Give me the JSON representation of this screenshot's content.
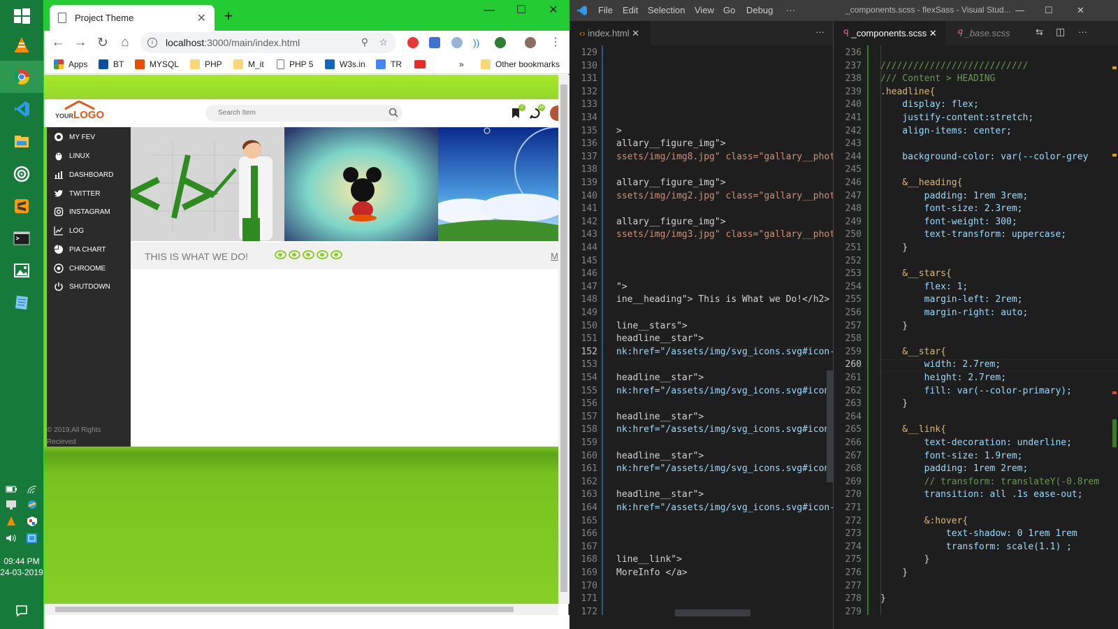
{
  "taskbar": {
    "icons": [
      "start-icon",
      "vlc-icon",
      "chrome-icon",
      "vscode-icon",
      "file-explorer-icon",
      "groove-icon",
      "sublime-icon",
      "terminal-icon",
      "photos-icon",
      "notepad-icon"
    ],
    "time": "09:44 PM",
    "date": "24-03-2019"
  },
  "chrome": {
    "tab_title": "Project Theme",
    "url_host": "localhost",
    "url_path": ":3000/main/index.html",
    "bookmarks": [
      "Apps",
      "BT",
      "MYSQL",
      "PHP",
      "M_it",
      "PHP 5",
      "W3s.in",
      "TR"
    ],
    "more_bookmarks": "»",
    "other_bookmarks": "Other bookmarks"
  },
  "site": {
    "logo_your": "YOUR",
    "logo_logo": "LOGO",
    "search_placeholder": "Search Item",
    "badge1": "0",
    "badge2": "16",
    "sidebar": [
      "MY FEV",
      "LINUX",
      "DASHBOARD",
      "TWITTER",
      "INSTAGRAM",
      "LOG",
      "PIA CHART",
      "CHROOME",
      "SHUTDOWN"
    ],
    "copyright_1": "© 2019,All Rights",
    "copyright_2": "Recieved",
    "headline": "THIS IS WHAT WE DO!",
    "more": "M"
  },
  "vscode": {
    "menu": [
      "File",
      "Edit",
      "Selection",
      "View",
      "Go",
      "Debug",
      "···"
    ],
    "window_title": "_components.scss - flexSass - Visual Stud...",
    "left_tab": "index.html",
    "right_tabs": [
      "_components.scss",
      "_base.scss"
    ],
    "left_lines": [
      {
        "n": "129",
        "t": ""
      },
      {
        "n": "130",
        "t": ""
      },
      {
        "n": "131",
        "t": ""
      },
      {
        "n": "132",
        "t": ""
      },
      {
        "n": "133",
        "t": ""
      },
      {
        "n": "134",
        "t": ""
      },
      {
        "n": "135",
        "t": ">"
      },
      {
        "n": "136",
        "t": "allary__figure_img\">"
      },
      {
        "n": "137",
        "t": "ssets/img/img8.jpg\" class=\"gallary__phot"
      },
      {
        "n": "138",
        "t": ""
      },
      {
        "n": "139",
        "t": "allary__figure_img\">"
      },
      {
        "n": "140",
        "t": "ssets/img/img2.jpg\" class=\"gallary__phot"
      },
      {
        "n": "141",
        "t": ""
      },
      {
        "n": "142",
        "t": "allary__figure_img\">"
      },
      {
        "n": "143",
        "t": "ssets/img/img3.jpg\" class=\"gallary__phot"
      },
      {
        "n": "144",
        "t": ""
      },
      {
        "n": "145",
        "t": ""
      },
      {
        "n": "146",
        "t": ""
      },
      {
        "n": "147",
        "t": "\">"
      },
      {
        "n": "148",
        "t": "ine__heading\"> This is What we Do!</h2>"
      },
      {
        "n": "149",
        "t": ""
      },
      {
        "n": "150",
        "t": "line__stars\">"
      },
      {
        "n": "151",
        "t": "headline__star\">"
      },
      {
        "n": "152",
        "t": "nk:href=\"/assets/img/svg_icons.svg#icon-"
      },
      {
        "n": "153",
        "t": ""
      },
      {
        "n": "154",
        "t": "headline__star\">"
      },
      {
        "n": "155",
        "t": "nk:href=\"/assets/img/svg_icons.svg#icon-"
      },
      {
        "n": "156",
        "t": ""
      },
      {
        "n": "157",
        "t": "headline__star\">"
      },
      {
        "n": "158",
        "t": "nk:href=\"/assets/img/svg_icons.svg#icon-"
      },
      {
        "n": "159",
        "t": ""
      },
      {
        "n": "160",
        "t": "headline__star\">"
      },
      {
        "n": "161",
        "t": "nk:href=\"/assets/img/svg_icons.svg#icon-"
      },
      {
        "n": "162",
        "t": ""
      },
      {
        "n": "163",
        "t": "headline__star\">"
      },
      {
        "n": "164",
        "t": "nk:href=\"/assets/img/svg_icons.svg#icon-"
      },
      {
        "n": "165",
        "t": ""
      },
      {
        "n": "166",
        "t": ""
      },
      {
        "n": "167",
        "t": ""
      },
      {
        "n": "168",
        "t": "line__link\">"
      },
      {
        "n": "169",
        "t": "MoreInfo </a>"
      },
      {
        "n": "170",
        "t": ""
      },
      {
        "n": "171",
        "t": ""
      },
      {
        "n": "172",
        "t": ""
      }
    ],
    "right_lines": [
      {
        "n": "236",
        "t": ""
      },
      {
        "n": "237",
        "t": "///////////////////////////"
      },
      {
        "n": "238",
        "t": "/// Content > HEADING"
      },
      {
        "n": "239",
        "t": ".headline{"
      },
      {
        "n": "240",
        "t": "    display: flex;"
      },
      {
        "n": "241",
        "t": "    justify-content:stretch;"
      },
      {
        "n": "242",
        "t": "    align-items: center;"
      },
      {
        "n": "243",
        "t": ""
      },
      {
        "n": "244",
        "t": "    background-color: var(--color-grey"
      },
      {
        "n": "245",
        "t": ""
      },
      {
        "n": "246",
        "t": "    &__heading{"
      },
      {
        "n": "247",
        "t": "        padding: 1rem 3rem;"
      },
      {
        "n": "248",
        "t": "        font-size: 2.3rem;"
      },
      {
        "n": "249",
        "t": "        font-weight: 300;"
      },
      {
        "n": "250",
        "t": "        text-transform: uppercase;"
      },
      {
        "n": "251",
        "t": "    }"
      },
      {
        "n": "252",
        "t": ""
      },
      {
        "n": "253",
        "t": "    &__stars{"
      },
      {
        "n": "254",
        "t": "        flex: 1;"
      },
      {
        "n": "255",
        "t": "        margin-left: 2rem;"
      },
      {
        "n": "256",
        "t": "        margin-right: auto;"
      },
      {
        "n": "257",
        "t": "    }"
      },
      {
        "n": "258",
        "t": ""
      },
      {
        "n": "259",
        "t": "    &__star{"
      },
      {
        "n": "260",
        "t": "        width: 2.7rem;"
      },
      {
        "n": "261",
        "t": "        height: 2.7rem;"
      },
      {
        "n": "262",
        "t": "        fill: var(--color-primary);"
      },
      {
        "n": "263",
        "t": "    }"
      },
      {
        "n": "264",
        "t": ""
      },
      {
        "n": "265",
        "t": "    &__link{"
      },
      {
        "n": "266",
        "t": "        text-decoration: underline;"
      },
      {
        "n": "267",
        "t": "        font-size: 1.9rem;"
      },
      {
        "n": "268",
        "t": "        padding: 1rem 2rem;"
      },
      {
        "n": "269",
        "t": "        // transform: translateY(-0.8rem"
      },
      {
        "n": "270",
        "t": "        transition: all .1s ease-out;"
      },
      {
        "n": "271",
        "t": ""
      },
      {
        "n": "272",
        "t": "        &:hover{"
      },
      {
        "n": "273",
        "t": "            text-shadow: 0 1rem 1rem"
      },
      {
        "n": "274",
        "t": "            transform: scale(1.1) ;"
      },
      {
        "n": "275",
        "t": "        }"
      },
      {
        "n": "276",
        "t": "    }"
      },
      {
        "n": "277",
        "t": ""
      },
      {
        "n": "278",
        "t": "}"
      },
      {
        "n": "279",
        "t": ""
      }
    ],
    "left_current_line": "152",
    "right_current_line": "260"
  },
  "colors": {
    "accent_green": "#8ccc2a",
    "chrome_frame": "#22cc32",
    "taskbar": "#167a3a",
    "vscode_bg": "#1e1e1e"
  }
}
